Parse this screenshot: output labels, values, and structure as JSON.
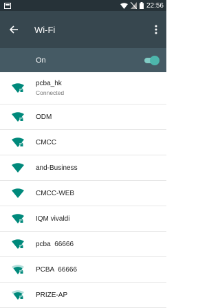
{
  "status_bar": {
    "time": "22:56",
    "icons": [
      "notification-icon",
      "wifi-signal-icon",
      "no-sim-icon",
      "battery-icon"
    ]
  },
  "app_bar": {
    "title": "Wi-Fi",
    "icons": [
      "back-arrow-icon",
      "more-vert-icon"
    ]
  },
  "wifi_toggle": {
    "label": "On",
    "state": "on",
    "accent_color": "#4db6ac"
  },
  "colors": {
    "status_bar": "#263238",
    "app_bar": "#37474f",
    "toggle_row": "#455a64",
    "wifi_icon": "#00897b"
  },
  "networks": [
    {
      "name": "pcba_hk",
      "status": "Connected",
      "icon": "wifi-lock-icon",
      "signal": "full"
    },
    {
      "name": "ODM",
      "icon": "wifi-lock-icon",
      "signal": "full"
    },
    {
      "name": "CMCC",
      "icon": "wifi-lock-icon",
      "signal": "full"
    },
    {
      "name": "and-Business",
      "icon": "wifi-icon",
      "signal": "full"
    },
    {
      "name": "CMCC-WEB",
      "icon": "wifi-icon",
      "signal": "full"
    },
    {
      "name": "IQM vivaldi",
      "icon": "wifi-lock-icon",
      "signal": "full"
    },
    {
      "name": "pcba  66666",
      "icon": "wifi-lock-icon",
      "signal": "full"
    },
    {
      "name": "PCBA  66666",
      "icon": "wifi-lock-icon",
      "signal": "medium"
    },
    {
      "name": "PRIZE-AP",
      "icon": "wifi-lock-icon",
      "signal": "medium"
    }
  ]
}
